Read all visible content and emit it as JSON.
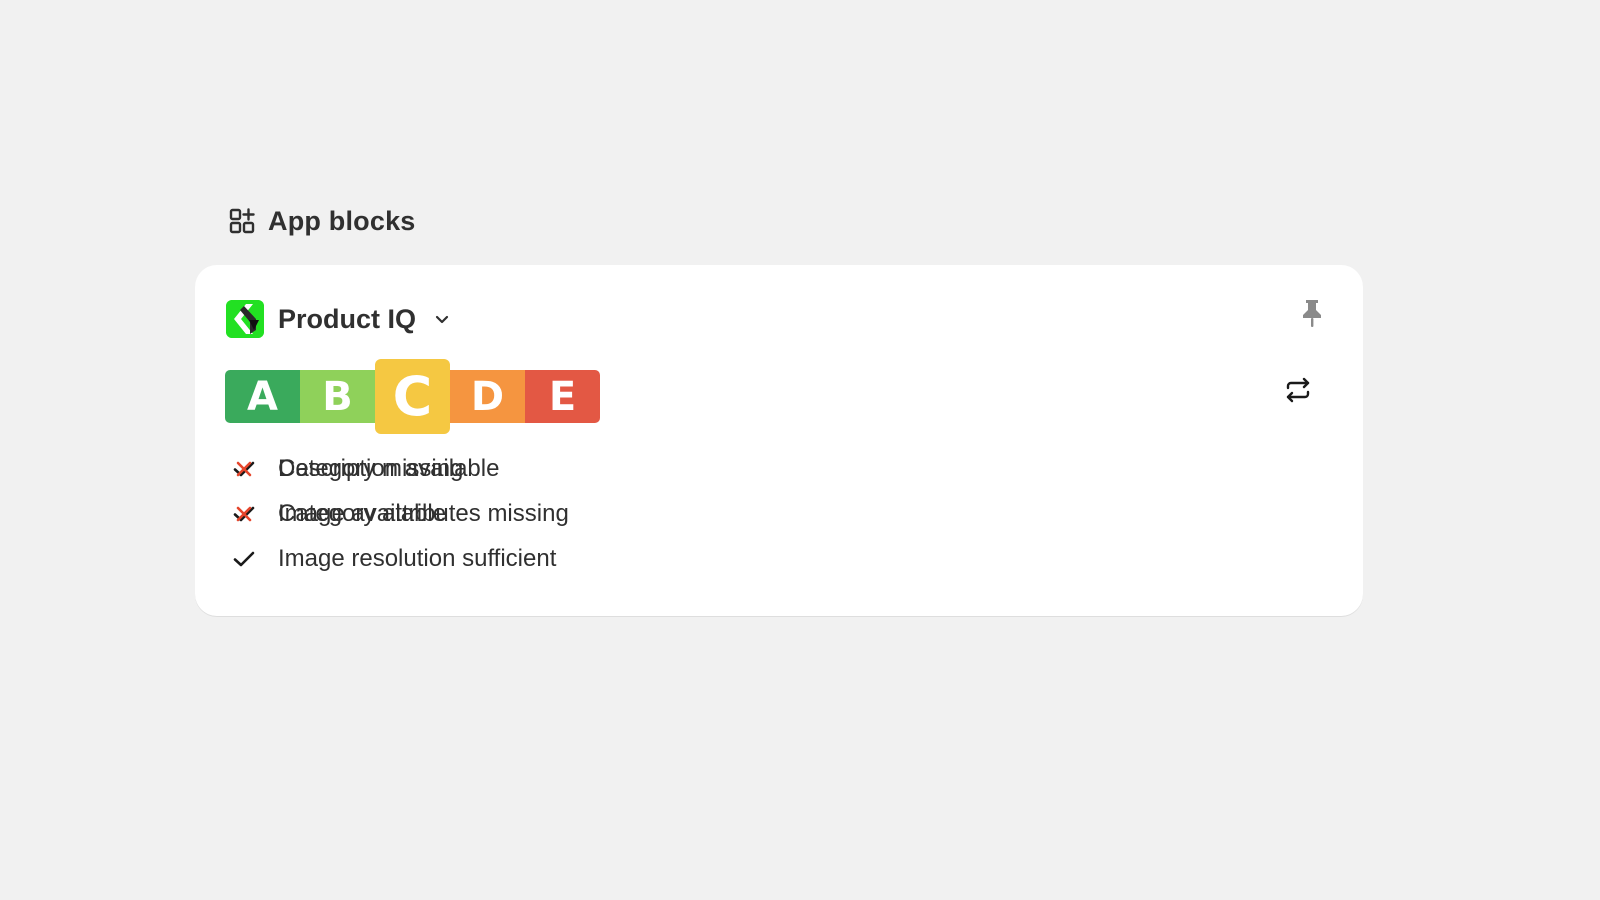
{
  "section": {
    "title": "App blocks",
    "icon": "apps-add-icon"
  },
  "app_block": {
    "app_name": "Product IQ",
    "logo_icon": "product-iq-logo-icon",
    "logo_color": "#22e022",
    "current_grade": "C",
    "grades": [
      {
        "letter": "A",
        "color": "#3aaa5c"
      },
      {
        "letter": "B",
        "color": "#8fd15a"
      },
      {
        "letter": "C",
        "color": "#f5c842"
      },
      {
        "letter": "D",
        "color": "#f59540"
      },
      {
        "letter": "E",
        "color": "#e35844"
      }
    ],
    "passed": [
      "Description available",
      "Image available",
      "Image resolution sufficient"
    ],
    "failed": [
      "Category missing",
      "Category attributes missing"
    ],
    "check_color": "#1a1a1a",
    "fail_color": "#e5452b"
  }
}
